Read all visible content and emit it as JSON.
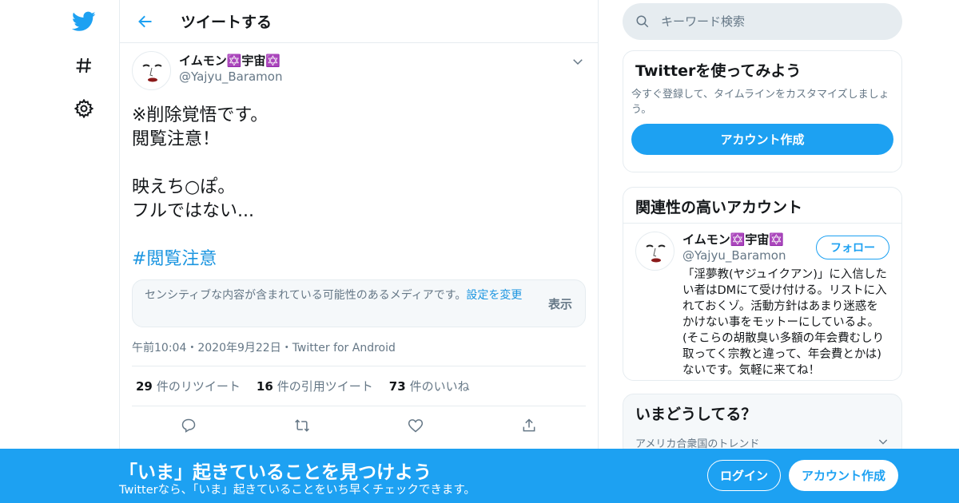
{
  "colors": {
    "accent": "#1da1f2",
    "link": "#1b95e0",
    "muted": "#657786",
    "text": "#14171a",
    "border": "#e6ecf0"
  },
  "nav": {
    "icons": [
      "twitter-bird-icon",
      "hashtag-icon",
      "gear-icon"
    ]
  },
  "header": {
    "title": "ツイートする",
    "back_icon": "arrow-left-icon"
  },
  "tweet": {
    "author_name": "イムモン✡️宇宙✡️",
    "author_handle": "@Yajyu_Baramon",
    "lines": [
      "※削除覚悟です。",
      "閲覧注意！",
      "",
      "映えち○ぽ。",
      "フルではない..."
    ],
    "hashtag": "#閲覧注意",
    "sensitive_text": "センシティブな内容が含まれている可能性のあるメディアです。",
    "sensitive_link": "設定を変更",
    "show_label": "表示",
    "timestamp": "午前10:04・2020年9月22日・Twitter for Android",
    "stats": [
      {
        "num": "29",
        "label": "件のリツイート"
      },
      {
        "num": "16",
        "label": "件の引用ツイート"
      },
      {
        "num": "73",
        "label": "件のいいね"
      }
    ]
  },
  "search": {
    "placeholder": "キーワード検索"
  },
  "signup_card": {
    "title": "Twitterを使ってみよう",
    "desc": "今すぐ登録して、タイムラインをカスタマイズしましょう。",
    "button": "アカウント作成"
  },
  "related_card": {
    "title": "関連性の高いアカウント",
    "user_name": "イムモン✡️宇宙✡️",
    "user_handle": "@Yajyu_Baramon",
    "follow": "フォロー",
    "bio": "「淫夢教(ヤジュイクアン)」に入信したい者はDMにて受け付ける。リストに入れておくゾ。活動方針はあまり迷惑をかけない事をモットーにしているよ。(そこらの胡散臭い多額の年会費むしり取ってく宗教と違って、年会費とかは)ないです。気軽に来てね！"
  },
  "trends_card": {
    "title": "いまどうしてる？",
    "sub": "アメリカ合衆国のトレンド"
  },
  "banner": {
    "title": "「いま」起きていることを見つけよう",
    "sub": "Twitterなら、「いま」起きていることをいち早くチェックできます。",
    "login": "ログイン",
    "signup": "アカウント作成"
  }
}
